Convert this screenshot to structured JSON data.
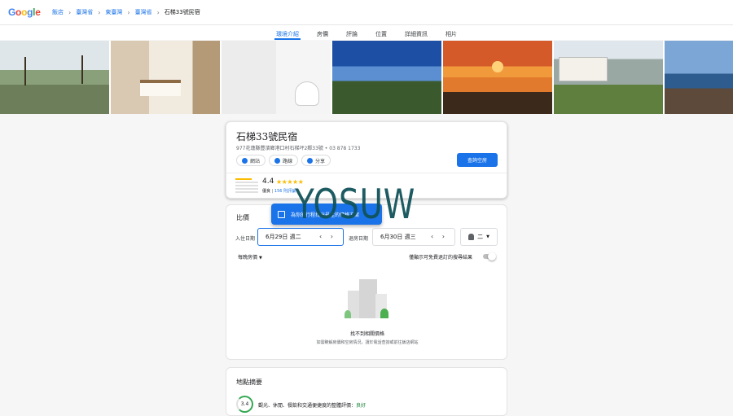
{
  "header": {
    "logo": "Google",
    "breadcrumbs": [
      "飯店",
      "臺灣省",
      "東臺灣",
      "臺灣省"
    ],
    "current": "石梯33號民宿"
  },
  "tabs": [
    {
      "label": "環境介紹",
      "active": true
    },
    {
      "label": "房價"
    },
    {
      "label": "評論"
    },
    {
      "label": "位置"
    },
    {
      "label": "詳細資訊"
    },
    {
      "label": "相片"
    }
  ],
  "hotel": {
    "name": "石梯33號民宿",
    "address": "977花蓮縣豐濱鄉港口村石梯坪2鄰33號 • 03 878 1733",
    "actions": [
      "網站",
      "路線",
      "分享"
    ],
    "check_button": "查詢空房",
    "rating": "4.4",
    "stars": "★★★★★",
    "rating_label": "優良",
    "reviews": "156 則評論"
  },
  "pricing": {
    "title": "比價",
    "tooltip": "為你的行程找出最佳的價格方案",
    "checkin_label": "入住日期",
    "checkin_value": "6月29日 週二",
    "checkout_label": "退房日期",
    "checkout_value": "6月30日 週三",
    "guests": "二",
    "price_dropdown": "每晚房價",
    "toggle_label": "僅顯示可免費退訂的搜尋結果",
    "empty_title": "找不到相關價格",
    "empty_sub": "如需瞭解房價和空房情況，請於電話查詢或前往飯店網站"
  },
  "location": {
    "title": "地點摘要",
    "score": "3.4",
    "text": "觀光、休閒、餐飲和交通便捷度的整體評價：",
    "rating": "良好"
  },
  "watermark": "YOSUW",
  "colors": {
    "accent": "#1a73e8",
    "star": "#fbbc04",
    "good": "#34a853"
  }
}
